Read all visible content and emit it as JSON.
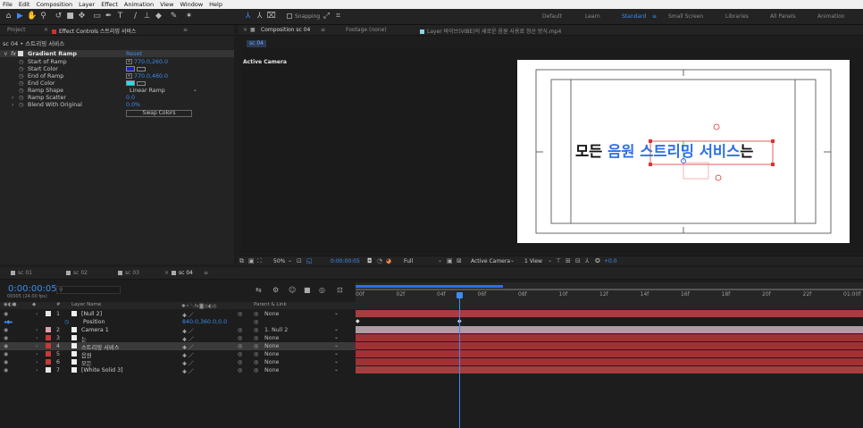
{
  "menu": [
    "File",
    "Edit",
    "Composition",
    "Layer",
    "Effect",
    "Animation",
    "View",
    "Window",
    "Help"
  ],
  "toolbar": {
    "snapping_label": "Snapping",
    "workspaces": [
      "Default",
      "Learn",
      "Standard",
      "Small Screen",
      "Libraries",
      "All Panels",
      "Animation"
    ],
    "active_workspace": "Standard"
  },
  "left_tabs": {
    "project": "Project",
    "effect_controls": "Effect Controls 스트리밍 서비스"
  },
  "effect": {
    "breadcrumb": "sc 04 • 스트리밍 서비스",
    "name": "Gradient Ramp",
    "reset": "Reset",
    "props": [
      {
        "name": "Start of Ramp",
        "value": "770.0,260.0"
      },
      {
        "name": "Start Color",
        "value": ""
      },
      {
        "name": "End of Ramp",
        "value": "770.0,460.0"
      },
      {
        "name": "End Color",
        "value": ""
      },
      {
        "name": "Ramp Shape",
        "value": "Linear Ramp"
      },
      {
        "name": "Ramp Scatter",
        "value": "0.0"
      },
      {
        "name": "Blend With Original",
        "value": "0.0%"
      }
    ],
    "swap_button": "Swap Colors",
    "start_color": "#1a1adc",
    "end_color": "#19e3f0"
  },
  "comp_tabs": {
    "composition": "Composition sc 04",
    "footage": "Footage (none)",
    "layer": "Layer 바이브(VIBE)의 새로운 음원 사용료 정산 방식.mp4",
    "sub": "sc 04"
  },
  "viewer": {
    "label": "Active Camera",
    "text_black1": "모든",
    "text_blue1": "음원",
    "text_blue2": "스트리밍 서비스",
    "text_black2": "는",
    "blue_color": "#2e6fe8"
  },
  "viewer_bar": {
    "zoom": "50%",
    "time": "0:00:00:05",
    "resolution": "Full",
    "camera": "Active Camera",
    "views": "1 View",
    "offset": "+0.0"
  },
  "timeline": {
    "tabs": [
      "sc 01",
      "sc 02",
      "sc 03",
      "sc 04"
    ],
    "timecode": "0:00:00:05",
    "fps": "00005 (24.00 fps)",
    "search_placeholder": "",
    "col_layer_name": "Layer Name",
    "col_parent": "Parent & Link",
    "ruler": [
      "00f",
      "02f",
      "04f",
      "06f",
      "08f",
      "10f",
      "12f",
      "14f",
      "16f",
      "18f",
      "20f",
      "22f",
      "01:00f"
    ],
    "layers": [
      {
        "num": "1",
        "name": "[Null 2]",
        "parent": "None",
        "color": "#e6e6e6"
      },
      {
        "num": "",
        "name": "Position",
        "parent": "",
        "color": "",
        "value": "840.0,360.0,0.0"
      },
      {
        "num": "2",
        "name": "Camera 1",
        "parent": "1. Null 2",
        "color": "#e0a0b0"
      },
      {
        "num": "3",
        "name": "는",
        "parent": "None",
        "color": "#c73a3a"
      },
      {
        "num": "4",
        "name": "스트리밍 서비스",
        "parent": "None",
        "color": "#c73a3a"
      },
      {
        "num": "5",
        "name": "음원",
        "parent": "None",
        "color": "#c73a3a"
      },
      {
        "num": "6",
        "name": "모든",
        "parent": "None",
        "color": "#c73a3a"
      },
      {
        "num": "7",
        "name": "[White Solid 3]",
        "parent": "None",
        "color": "#e6e6e6"
      }
    ]
  }
}
